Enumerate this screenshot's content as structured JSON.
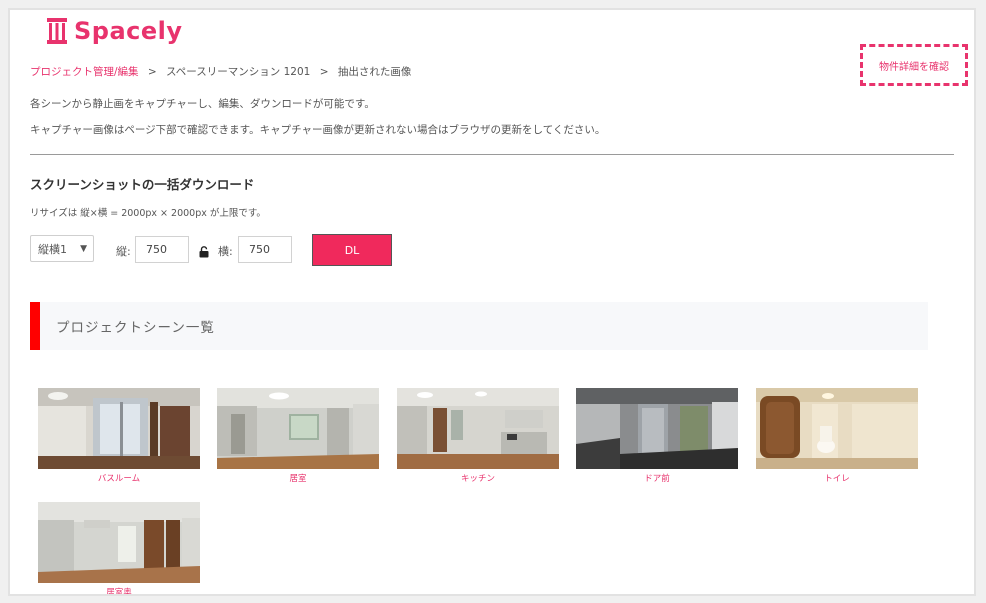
{
  "brand": {
    "name": "Spacely",
    "color": "#e8336d"
  },
  "breadcrumb": {
    "link": "プロジェクト管理/編集",
    "separator": ">",
    "items": [
      "スペースリーマンション 1201",
      "抽出された画像"
    ]
  },
  "detail_button": {
    "label": "物件詳細を確認"
  },
  "descriptions": [
    "各シーンから静止画をキャプチャーし、編集、ダウンロードが可能です。",
    "キャプチャー画像はページ下部で確認できます。キャプチャー画像が更新されない場合はブラウザの更新をしてください。"
  ],
  "bulk_download": {
    "title": "スクリーンショットの一括ダウンロード",
    "resize_note": "リサイズは 縦×横 = 2000px × 2000px が上限です。",
    "ratio_select": "縦横1",
    "height_label": "縦:",
    "height_value": "750",
    "width_label": "横:",
    "width_value": "750",
    "dl_label": "DL",
    "accent_color": "#f0295c"
  },
  "scene_list": {
    "title": "プロジェクトシーン一覧",
    "scenes": [
      {
        "caption": "バスルーム",
        "icon": "bathroom-panorama"
      },
      {
        "caption": "居室",
        "icon": "living-room-panorama"
      },
      {
        "caption": "キッチン",
        "icon": "kitchen-panorama"
      },
      {
        "caption": "ドア前",
        "icon": "door-front-panorama"
      },
      {
        "caption": "トイレ",
        "icon": "toilet-panorama"
      },
      {
        "caption": "居室奥",
        "icon": "back-room-panorama"
      }
    ]
  }
}
